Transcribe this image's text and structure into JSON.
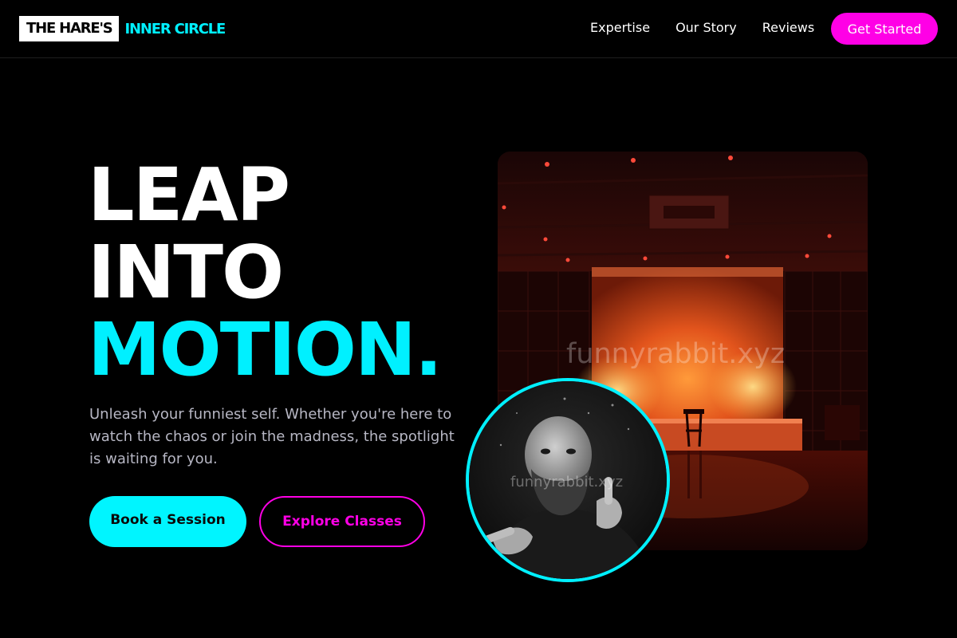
{
  "brand": {
    "part1": "THE HARE'S",
    "part2": "INNER CIRCLE"
  },
  "nav": {
    "items": [
      "Expertise",
      "Our Story",
      "Reviews"
    ],
    "cta": "Get Started"
  },
  "hero": {
    "headline_line1": "LEAP",
    "headline_line2": "INTO",
    "headline_line3": "MOTION.",
    "subtitle": "Unleash your funniest self. Whether you're here to watch the chaos or join the madness, the spotlight is waiting for you.",
    "primary_button": "Book a Session",
    "secondary_button": "Explore Classes"
  },
  "images": {
    "stage_watermark": "funnyrabbit.xyz",
    "avatar_watermark": "funnyrabbit.xyz"
  },
  "colors": {
    "accent_cyan": "#00f0ff",
    "accent_magenta": "#ff00e6",
    "background": "#000000"
  }
}
